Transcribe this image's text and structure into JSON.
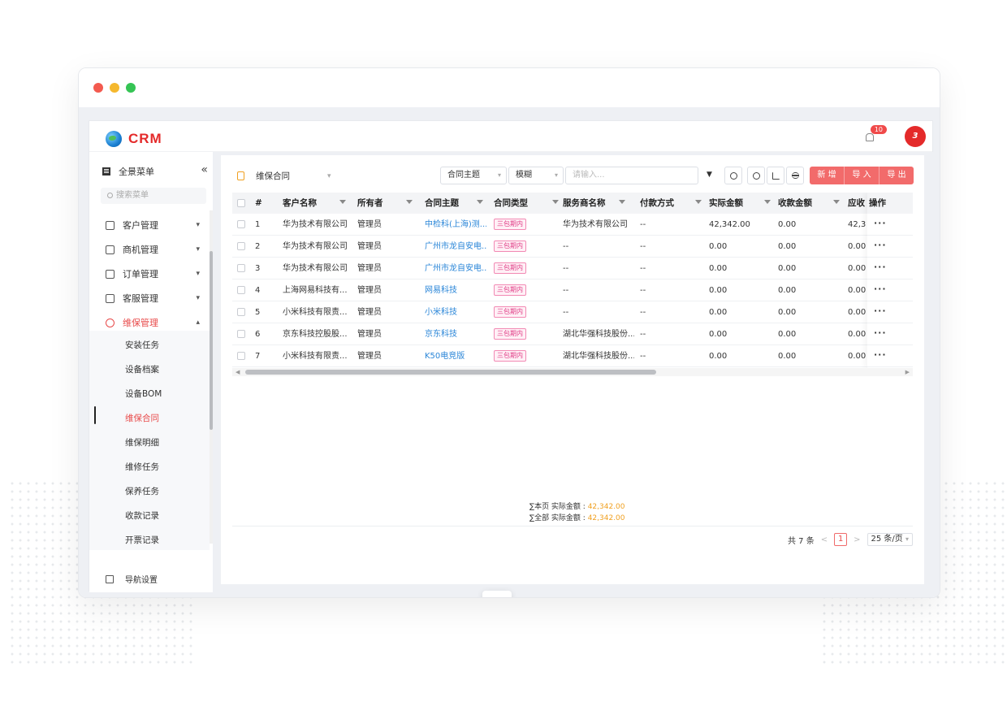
{
  "app": {
    "logo_text": "CRM",
    "notification_count": "10",
    "avatar_text": "3"
  },
  "sidebar": {
    "menu_title": "全景菜单",
    "collapse_icon": "«",
    "search_placeholder": "搜索菜单",
    "items": [
      {
        "label": "客户管理",
        "icon": "user-icon"
      },
      {
        "label": "商机管理",
        "icon": "briefcase-icon"
      },
      {
        "label": "订单管理",
        "icon": "order-icon"
      },
      {
        "label": "客服管理",
        "icon": "headset-icon"
      },
      {
        "label": "维保管理",
        "icon": "wrench-icon",
        "active": true
      }
    ],
    "sub_items": [
      "安装任务",
      "设备档案",
      "设备BOM",
      "维保合同",
      "维保明细",
      "维修任务",
      "保养任务",
      "收款记录",
      "开票记录"
    ],
    "active_sub": "维保合同",
    "bottom_label": "导航设置"
  },
  "toolbar": {
    "view_name": "维保合同",
    "field_select": "合同主题",
    "match_select": "模糊",
    "search_placeholder": "请输入...",
    "buttons": [
      "新 增",
      "导 入",
      "导 出"
    ]
  },
  "table": {
    "columns": [
      "#",
      "客户名称",
      "所有者",
      "合同主题",
      "合同类型",
      "服务商名称",
      "付款方式",
      "实际金额",
      "收款金额",
      "应收",
      "操作"
    ],
    "rows": [
      {
        "no": "1",
        "customer": "华为技术有限公司",
        "owner": "管理员",
        "subject": "中检科(上海)测...",
        "type": "三包期内",
        "provider": "华为技术有限公司",
        "payment": "--",
        "amount": "42,342.00",
        "received": "0.00",
        "due": "42,3"
      },
      {
        "no": "2",
        "customer": "华为技术有限公司",
        "owner": "管理员",
        "subject": "广州市龙自安电...",
        "type": "三包期内",
        "provider": "--",
        "payment": "--",
        "amount": "0.00",
        "received": "0.00",
        "due": "0.00"
      },
      {
        "no": "3",
        "customer": "华为技术有限公司",
        "owner": "管理员",
        "subject": "广州市龙自安电...",
        "type": "三包期内",
        "provider": "--",
        "payment": "--",
        "amount": "0.00",
        "received": "0.00",
        "due": "0.00"
      },
      {
        "no": "4",
        "customer": "上海网易科技有...",
        "owner": "管理员",
        "subject": "网易科技",
        "type": "三包期内",
        "provider": "--",
        "payment": "--",
        "amount": "0.00",
        "received": "0.00",
        "due": "0.00"
      },
      {
        "no": "5",
        "customer": "小米科技有限责...",
        "owner": "管理员",
        "subject": "小米科技",
        "type": "三包期内",
        "provider": "--",
        "payment": "--",
        "amount": "0.00",
        "received": "0.00",
        "due": "0.00"
      },
      {
        "no": "6",
        "customer": "京东科技控股股...",
        "owner": "管理员",
        "subject": "京东科技",
        "type": "三包期内",
        "provider": "湖北华强科技股份...",
        "payment": "--",
        "amount": "0.00",
        "received": "0.00",
        "due": "0.00"
      },
      {
        "no": "7",
        "customer": "小米科技有限责...",
        "owner": "管理员",
        "subject": "K50电竞版",
        "type": "三包期内",
        "provider": "湖北华强科技股份...",
        "payment": "--",
        "amount": "0.00",
        "received": "0.00",
        "due": "0.00"
      }
    ],
    "more_label": "···"
  },
  "summary": {
    "page_label": "∑本页 实际金额 :",
    "page_value": "42,342.00",
    "all_label": "∑全部 实际金额 :",
    "all_value": "42,342.00"
  },
  "pager": {
    "total": "共 7 条",
    "current": "1",
    "size": "25 条/页"
  },
  "colors": {
    "accent": "#e84a4a",
    "link": "#2a86d8",
    "tag": "#e03d86",
    "sum": "#f0a020"
  }
}
